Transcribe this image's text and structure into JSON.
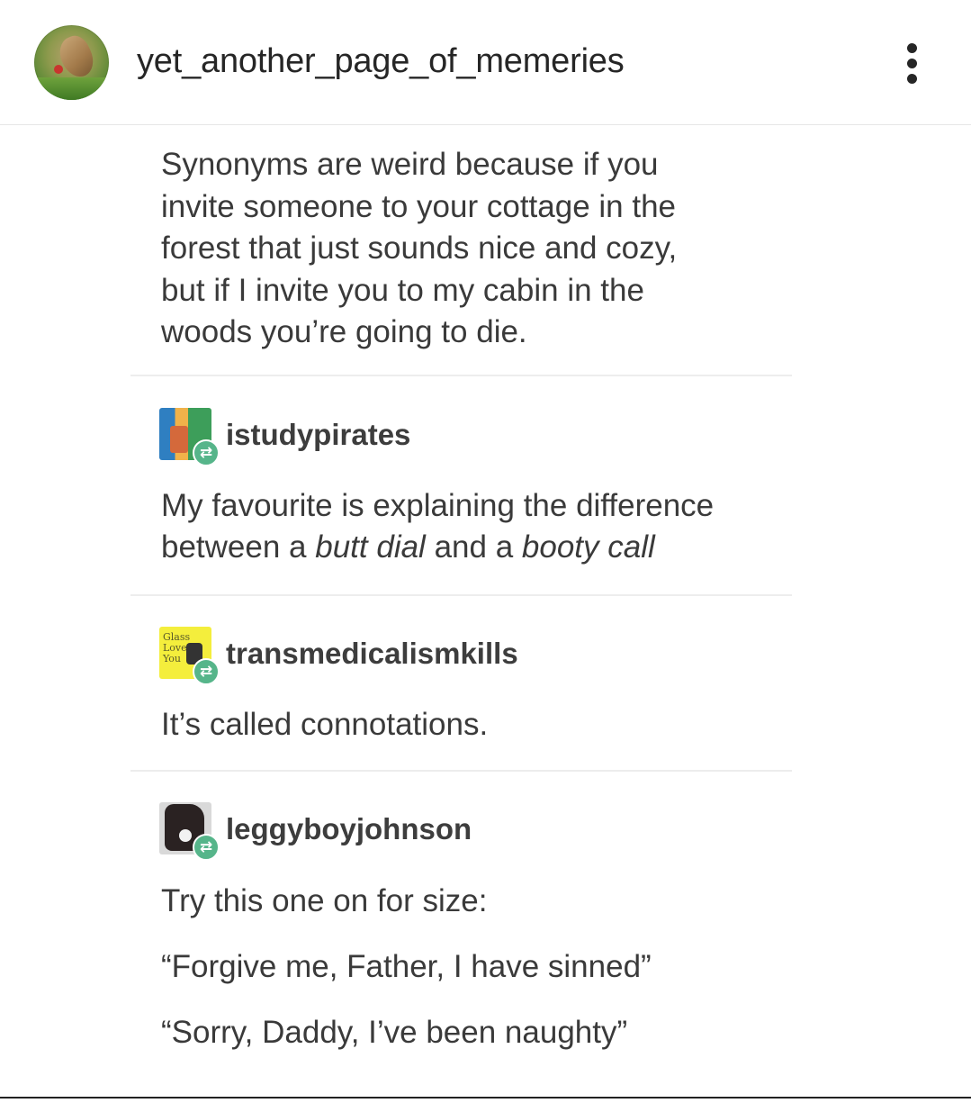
{
  "header": {
    "username": "yet_another_page_of_memeries",
    "avatar_icon": "bird-avatar",
    "more_icon": "more-vertical-icon"
  },
  "post": {
    "original_text_lines": [
      "Synonyms are weird because if you",
      "invite someone to your cottage in the",
      "forest that just sounds nice and cozy,",
      "but if I invite you to my cabin in the",
      "woods you’re going to die."
    ],
    "reblogs": [
      {
        "username": "istudypirates",
        "badge_icon": "reblog-icon",
        "text_lines": [
          [
            "My favourite is explaining the difference"
          ],
          [
            "between a ",
            "butt dial",
            " and a ",
            "booty call"
          ]
        ]
      },
      {
        "username": "transmedicalismkills",
        "badge_icon": "reblog-icon",
        "avatar_text": "Glass Loves You",
        "text_lines": [
          [
            "It’s called connotations."
          ]
        ]
      },
      {
        "username": "leggyboyjohnson",
        "badge_icon": "reblog-icon",
        "text_lines": [
          [
            "Try this one on for size:"
          ],
          [
            "“Forgive me, Father, I have sinned”"
          ],
          [
            "“Sorry, Daddy, I’ve been naughty”"
          ]
        ]
      }
    ]
  },
  "colors": {
    "text": "#262626",
    "body_text": "#3a3a3a",
    "divider": "#ededed",
    "reblog_badge": "#56b58a",
    "pirates_avatar": "#2f7fc1",
    "trans_avatar": "#f4ee3c"
  }
}
